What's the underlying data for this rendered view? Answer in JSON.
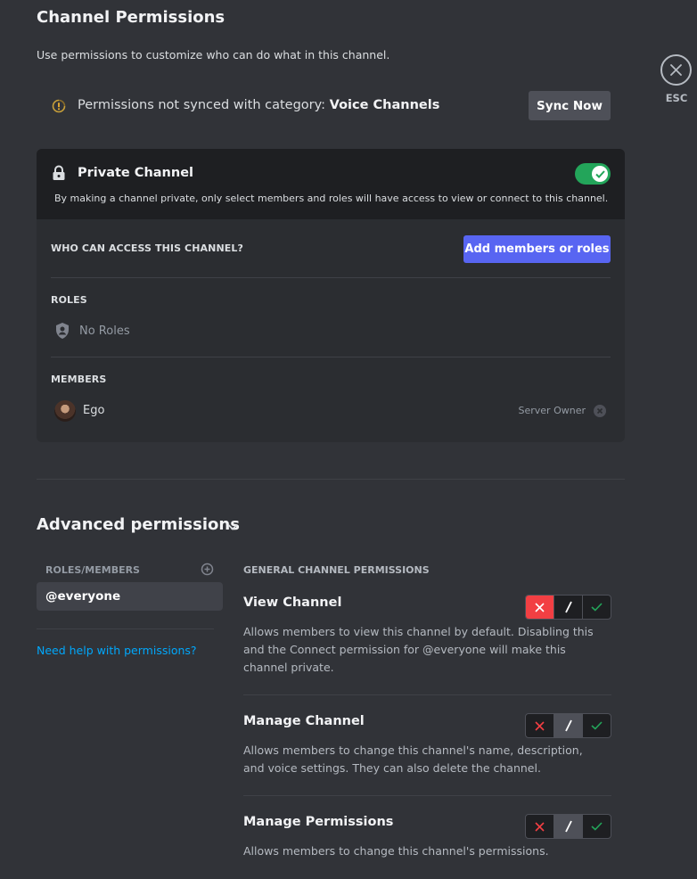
{
  "header": {
    "title": "Channel Permissions",
    "description": "Use permissions to customize who can do what in this channel."
  },
  "esc": {
    "label": "ESC",
    "icon": "close-icon"
  },
  "sync": {
    "text_prefix": "Permissions not synced with category: ",
    "category": "Voice Channels",
    "button": "Sync Now",
    "icon": "sync-warning-icon"
  },
  "private_channel": {
    "title": "Private Channel",
    "description": "By making a channel private, only select members and roles will have access to view or connect to this channel.",
    "enabled": true,
    "toggle_color": "#23a55a"
  },
  "access": {
    "heading": "WHO CAN ACCESS THIS CHANNEL?",
    "add_button": "Add members or roles",
    "roles_heading": "ROLES",
    "roles_empty": "No Roles",
    "members_heading": "MEMBERS",
    "members": [
      {
        "name": "Ego",
        "tag": "Server Owner"
      }
    ]
  },
  "advanced": {
    "title": "Advanced permissions",
    "roles_members_label": "ROLES/MEMBERS",
    "selected_role": "@everyone",
    "help_link": "Need help with permissions?",
    "general_label": "GENERAL CHANNEL PERMISSIONS",
    "permissions": [
      {
        "title": "View Channel",
        "description": "Allows members to view this channel by default. Disabling this and the Connect permission for @everyone will make this channel private.",
        "state": "deny"
      },
      {
        "title": "Manage Channel",
        "description": "Allows members to change this channel's name, description, and voice settings. They can also delete the channel.",
        "state": "neutral"
      },
      {
        "title": "Manage Permissions",
        "description": "Allows members to change this channel's permissions.",
        "state": "neutral"
      }
    ]
  },
  "colors": {
    "background": "#313338",
    "accent": "#5865f2",
    "deny": "#f23f43",
    "allow": "#23a55a",
    "link": "#00a8fc"
  }
}
